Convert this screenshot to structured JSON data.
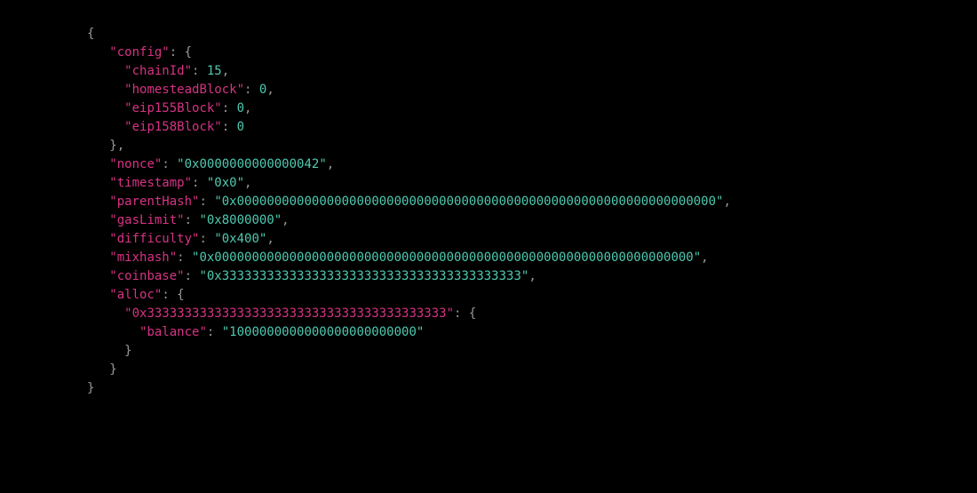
{
  "genesis": {
    "config": {
      "chainId": 15,
      "homesteadBlock": 0,
      "eip155Block": 0,
      "eip158Block": 0
    },
    "nonce": "0x0000000000000042",
    "timestamp": "0x0",
    "parentHash": "0x0000000000000000000000000000000000000000000000000000000000000000",
    "gasLimit": "0x8000000",
    "difficulty": "0x400",
    "mixhash": "0x0000000000000000000000000000000000000000000000000000000000000000",
    "coinbase": "0x3333333333333333333333333333333333333333",
    "alloc_address": "0x3333333333333333333333333333333333333333",
    "alloc_balance": "1000000000000000000000000"
  },
  "labels": {
    "config": "\"config\"",
    "chainId": "\"chainId\"",
    "homesteadBlock": "\"homesteadBlock\"",
    "eip155Block": "\"eip155Block\"",
    "eip158Block": "\"eip158Block\"",
    "nonce": "\"nonce\"",
    "timestamp": "\"timestamp\"",
    "parentHash": "\"parentHash\"",
    "gasLimit": "\"gasLimit\"",
    "difficulty": "\"difficulty\"",
    "mixhash": "\"mixhash\"",
    "coinbase": "\"coinbase\"",
    "alloc": "\"alloc\"",
    "balance": "\"balance\""
  },
  "quoted": {
    "nonce": "\"0x0000000000000042\"",
    "timestamp": "\"0x0\"",
    "parentHash": "\"0x0000000000000000000000000000000000000000000000000000000000000000\"",
    "gasLimit": "\"0x8000000\"",
    "difficulty": "\"0x400\"",
    "mixhash": "\"0x0000000000000000000000000000000000000000000000000000000000000000\"",
    "coinbase": "\"0x3333333333333333333333333333333333333333\"",
    "alloc_address": "\"0x3333333333333333333333333333333333333333\"",
    "alloc_balance": "\"1000000000000000000000000\""
  }
}
